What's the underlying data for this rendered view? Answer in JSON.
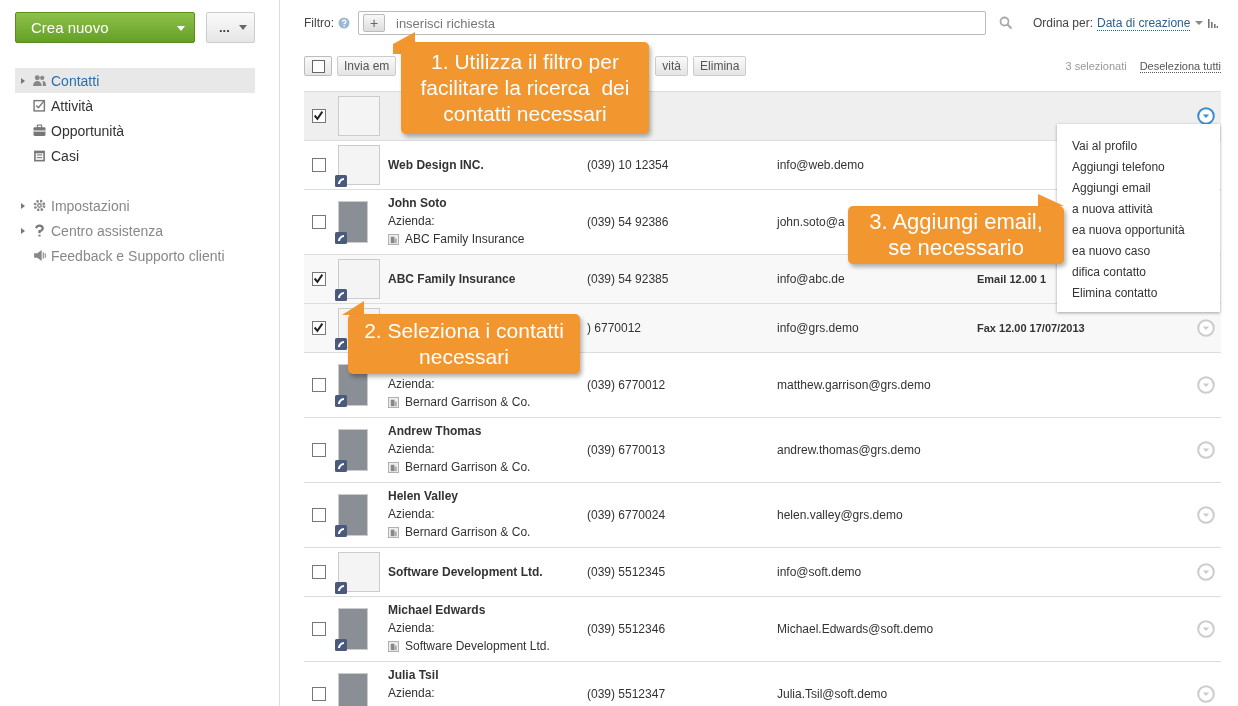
{
  "sidebar": {
    "create_button": "Crea nuovo",
    "more_button": "...",
    "nav": [
      {
        "label": "Contatti",
        "selected": true,
        "expandable": true
      },
      {
        "label": "Attività",
        "selected": false,
        "expandable": false
      },
      {
        "label": "Opportunità",
        "selected": false,
        "expandable": false
      },
      {
        "label": "Casi",
        "selected": false,
        "expandable": false
      }
    ],
    "secondary": [
      {
        "label": "Impostazioni",
        "expandable": true
      },
      {
        "label": "Centro assistenza",
        "expandable": true
      },
      {
        "label": "Feedback e Supporto clienti",
        "expandable": false
      }
    ]
  },
  "filter": {
    "label": "Filtro:",
    "add_button": "+",
    "placeholder": "inserisci richiesta"
  },
  "sort": {
    "label": "Ordina per:",
    "value": "Data di creazione"
  },
  "toolbar": {
    "select_all_checked": false,
    "buttons": [
      "Invia em",
      "vità",
      "Elimina"
    ],
    "selected_count": "3 selezionati",
    "deselect_all": "Deseleziona tutti"
  },
  "contacts": [
    {
      "checked": true,
      "menu_open": true,
      "kind": "logo",
      "badge": false
    },
    {
      "checked": false,
      "menu_open": false,
      "kind": "logo",
      "badge": true,
      "name": "Web Design INC.",
      "phone": "(039) 10 12354",
      "email": "info@web.demo"
    },
    {
      "checked": false,
      "menu_open": false,
      "kind": "photo",
      "badge": true,
      "name": "John Soto",
      "company_label": "Azienda:",
      "company": "ABC Family Insurance",
      "phone": "(039) 54 92386",
      "email": "john.soto@a"
    },
    {
      "checked": true,
      "menu_open": false,
      "kind": "logo",
      "badge": true,
      "name": "ABC Family Insurance",
      "phone": "(039) 54 92385",
      "email": "info@abc.de",
      "last_activity": "Email 12.00 1"
    },
    {
      "checked": true,
      "menu_open": false,
      "kind": "logo",
      "badge": true,
      "phone": ") 6770012",
      "email": "info@grs.demo",
      "last_activity": "Fax 12.00 17/07/2013"
    },
    {
      "checked": false,
      "menu_open": false,
      "kind": "photo",
      "badge": true,
      "company_label": "Azienda:",
      "company": "Bernard Garrison & Co.",
      "phone": "(039) 6770012",
      "email": "matthew.garrison@grs.demo"
    },
    {
      "checked": false,
      "menu_open": false,
      "kind": "photo",
      "badge": true,
      "name": "Andrew Thomas",
      "company_label": "Azienda:",
      "company": "Bernard Garrison & Co.",
      "phone": "(039) 6770013",
      "email": "andrew.thomas@grs.demo"
    },
    {
      "checked": false,
      "menu_open": false,
      "kind": "photo",
      "badge": true,
      "name": "Helen Valley",
      "company_label": "Azienda:",
      "company": "Bernard Garrison & Co.",
      "phone": "(039) 6770024",
      "email": "helen.valley@grs.demo"
    },
    {
      "checked": false,
      "menu_open": false,
      "kind": "logo",
      "badge": true,
      "name": "Software Development Ltd.",
      "phone": "(039) 5512345",
      "email": "info@soft.demo"
    },
    {
      "checked": false,
      "menu_open": false,
      "kind": "photo",
      "badge": true,
      "name": "Michael Edwards",
      "company_label": "Azienda:",
      "company": "Software Development Ltd.",
      "phone": "(039) 5512346",
      "email": "Michael.Edwards@soft.demo"
    },
    {
      "checked": false,
      "menu_open": false,
      "kind": "photo",
      "badge": false,
      "name": "Julia Tsil",
      "company_label": "Azienda:",
      "phone": "(039) 5512347",
      "email": "Julia.Tsil@soft.demo"
    }
  ],
  "context_menu": {
    "items": [
      "Vai al profilo",
      "Aggiungi telefono",
      "Aggiungi email",
      "a nuova attività",
      "ea nuova opportunità",
      "ea nuovo caso",
      "difica contatto",
      "Elimina contatto"
    ]
  },
  "callouts": [
    {
      "lines": [
        "1. Utilizza il filtro per",
        "facilitare la ricerca  dei",
        "contatti necessari"
      ]
    },
    {
      "lines": [
        "2. Seleziona i contatti",
        "necessari"
      ]
    },
    {
      "lines": [
        "3. Aggiungi email,",
        "se necessario"
      ]
    }
  ]
}
